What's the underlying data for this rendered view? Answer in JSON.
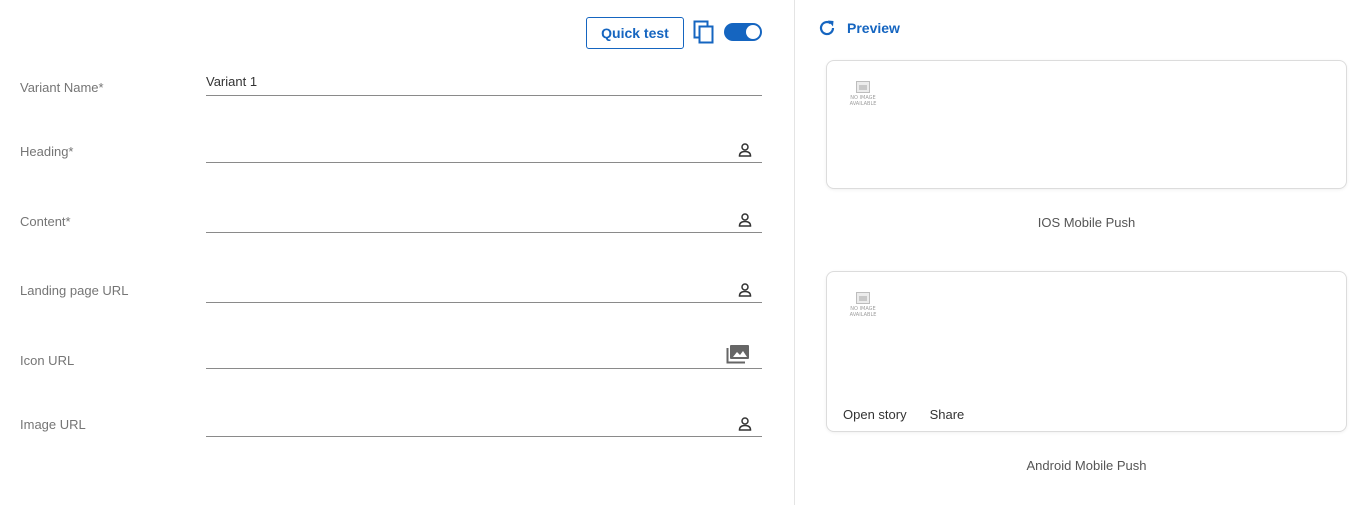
{
  "toolbar": {
    "quick_test_label": "Quick test",
    "copy_icon": "copy-icon",
    "toggle_state": true,
    "accent_color": "#1565c0"
  },
  "form": {
    "fields": [
      {
        "label": "Variant Name*",
        "value": "Variant 1",
        "icon": ""
      },
      {
        "label": "Heading*",
        "value": "",
        "icon": "person-icon"
      },
      {
        "label": "Content*",
        "value": "",
        "icon": "person-icon"
      },
      {
        "label": "Landing page URL",
        "value": "",
        "icon": "person-icon"
      },
      {
        "label": "Icon URL",
        "value": "",
        "icon": "image-gallery-icon"
      },
      {
        "label": "Image URL",
        "value": "",
        "icon": "person-icon"
      }
    ]
  },
  "preview": {
    "title": "Preview",
    "icon": "refresh-icon",
    "no_image_text": "NO IMAGE AVAILABLE",
    "ios_caption": "IOS Mobile Push",
    "android_caption": "Android Mobile Push",
    "android_actions": [
      "Open story",
      "Share"
    ]
  }
}
